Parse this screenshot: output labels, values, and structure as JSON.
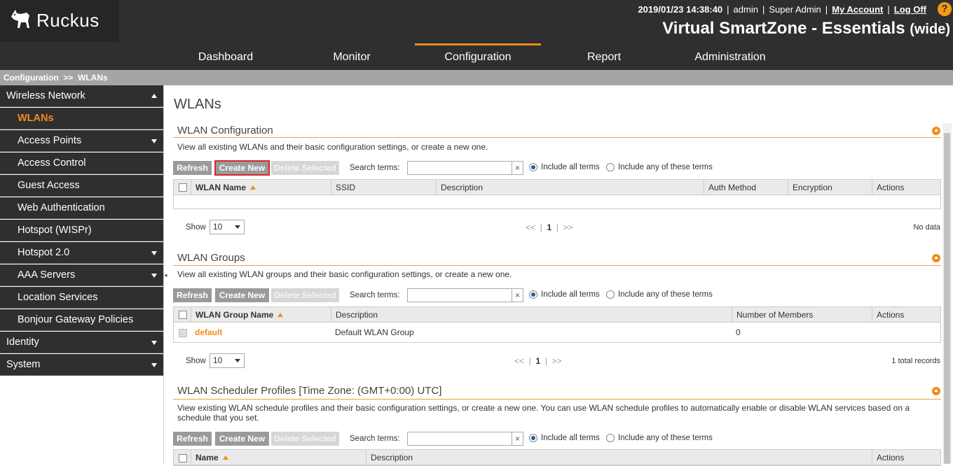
{
  "brand": {
    "logo_text": "Ruckus"
  },
  "header": {
    "datetime": "2019/01/23 14:38:40",
    "user": "admin",
    "role": "Super Admin",
    "my_account": "My Account",
    "log_off": "Log Off",
    "help": "?",
    "product": "Virtual SmartZone - Essentials",
    "product_suffix": "(wide)"
  },
  "nav": {
    "tabs": [
      {
        "label": "Dashboard"
      },
      {
        "label": "Monitor"
      },
      {
        "label": "Configuration",
        "active": true
      },
      {
        "label": "Report"
      },
      {
        "label": "Administration"
      }
    ]
  },
  "breadcrumb": {
    "root": "Configuration",
    "sep": ">>",
    "current": "WLANs"
  },
  "sidebar": {
    "items": [
      {
        "label": "Wireless Network",
        "level": "top",
        "caret": "up"
      },
      {
        "label": "WLANs",
        "level": "sub",
        "selected": true
      },
      {
        "label": "Access Points",
        "level": "sub",
        "caret": "down"
      },
      {
        "label": "Access Control",
        "level": "sub"
      },
      {
        "label": "Guest Access",
        "level": "sub"
      },
      {
        "label": "Web Authentication",
        "level": "sub"
      },
      {
        "label": "Hotspot (WISPr)",
        "level": "sub"
      },
      {
        "label": "Hotspot 2.0",
        "level": "sub",
        "caret": "down"
      },
      {
        "label": "AAA Servers",
        "level": "sub",
        "caret": "down"
      },
      {
        "label": "Location Services",
        "level": "sub"
      },
      {
        "label": "Bonjour Gateway Policies",
        "level": "sub"
      },
      {
        "label": "Identity",
        "level": "top",
        "caret": "down"
      },
      {
        "label": "System",
        "level": "top",
        "caret": "down"
      }
    ]
  },
  "page": {
    "title": "WLANs"
  },
  "common": {
    "refresh": "Refresh",
    "create_new": "Create New",
    "delete_selected": "Delete Selected",
    "search_terms": "Search terms:",
    "include_all": "Include all terms",
    "include_any": "Include any of these terms",
    "show": "Show",
    "show_value": "10",
    "prev": "<<",
    "page": "1",
    "next": ">>",
    "clear": "×"
  },
  "wlan_config": {
    "title": "WLAN Configuration",
    "desc": "View all existing WLANs and their basic configuration settings, or create a new one.",
    "columns": [
      "WLAN Name",
      "SSID",
      "Description",
      "Auth Method",
      "Encryption",
      "Actions"
    ],
    "rows": [],
    "records": "No data"
  },
  "wlan_groups": {
    "title": "WLAN Groups",
    "desc": "View all existing WLAN groups and their basic configuration settings, or create a new one.",
    "columns": [
      "WLAN Group Name",
      "Description",
      "Number of Members",
      "Actions"
    ],
    "rows": [
      {
        "name": "default",
        "description": "Default WLAN Group",
        "members": "0"
      }
    ],
    "records": "1 total records"
  },
  "scheduler": {
    "title": "WLAN Scheduler Profiles [Time Zone: (GMT+0:00) UTC]",
    "desc": "View existing WLAN schedule profiles and their basic configuration settings, or create a new one. You can use WLAN schedule profiles to automatically enable or disable WLAN services based on a schedule that you set.",
    "columns": [
      "Name",
      "Description",
      "Actions"
    ]
  }
}
